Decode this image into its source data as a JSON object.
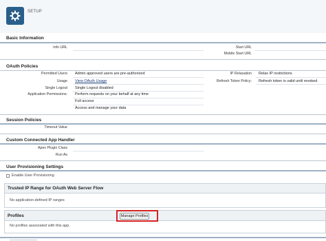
{
  "header": {
    "title": "SETUP",
    "icon": "gear-icon",
    "accent": "#2b5f8b"
  },
  "basic_info": {
    "title": "Basic Information",
    "left_labels": [
      "Info URL"
    ],
    "right_labels": [
      "Start URL",
      "Mobile Start URL"
    ]
  },
  "oauth": {
    "title": "OAuth Policies",
    "permitted_users_label": "Permitted Users",
    "permitted_users_value": "Admin approved users are pre-authorized",
    "usage_label": "Usage",
    "usage_value": "View OAuth Usage",
    "single_logout_label": "Single Logout",
    "single_logout_value": "Single Logout disabled",
    "app_permissions_label": "Application Permissions:",
    "permissions": [
      "Perform requests on your behalf at any time",
      "Full access",
      "Access and manage your data"
    ],
    "ip_relaxation_label": "IP Relaxation",
    "ip_relaxation_value": "Relax IP restrictions",
    "refresh_policy_label": "Refresh Token Policy:",
    "refresh_policy_value": "Refresh token is valid until revoked"
  },
  "session": {
    "title": "Session Policies",
    "timeout_label": "Timeout Value"
  },
  "custom_handler": {
    "title": "Custom Connected App Handler",
    "apex_label": "Apex Plugin Class",
    "run_as_label": "Run As"
  },
  "provisioning": {
    "title": "User Provisioning Settings",
    "enable_label": "Enable User Provisioning"
  },
  "trusted_ip": {
    "title": "Trusted IP Range for OAuth Web Server Flow",
    "empty_text": "No application-defined IP ranges"
  },
  "profiles": {
    "title": "Profiles",
    "button_label": "Manage Profiles",
    "empty_text": "No profiles associated with this app."
  }
}
